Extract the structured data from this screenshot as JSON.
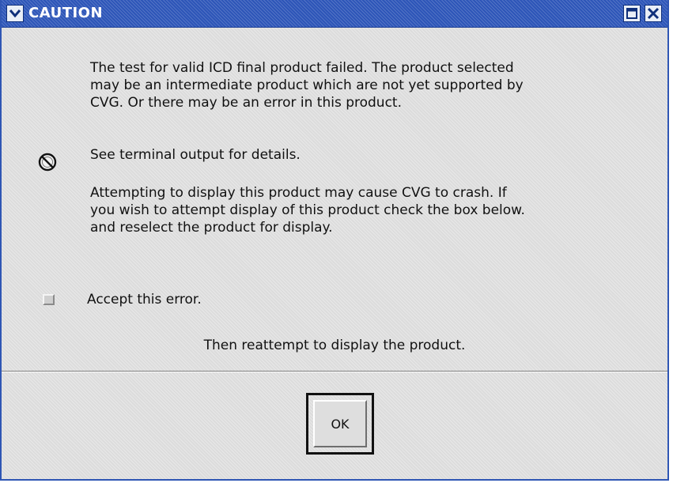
{
  "window": {
    "title": "CAUTION",
    "accent_color": "#2d55b8"
  },
  "message": {
    "paragraph_1": "The test for valid ICD final product failed. The product selected\nmay be an intermediate product which are not yet supported by\nCVG.  Or there may be an error in this product.",
    "paragraph_2": "See terminal output for details.",
    "paragraph_3": "Attempting to display this product may cause CVG to crash.  If\nyou wish to attempt display of this product check the box below.\nand reselect the product for display.",
    "icon": "prohibited-icon"
  },
  "checkbox": {
    "label": "Accept this error.",
    "checked": false
  },
  "hint": "Then reattempt to display the product.",
  "buttons": {
    "ok_label": "OK"
  }
}
